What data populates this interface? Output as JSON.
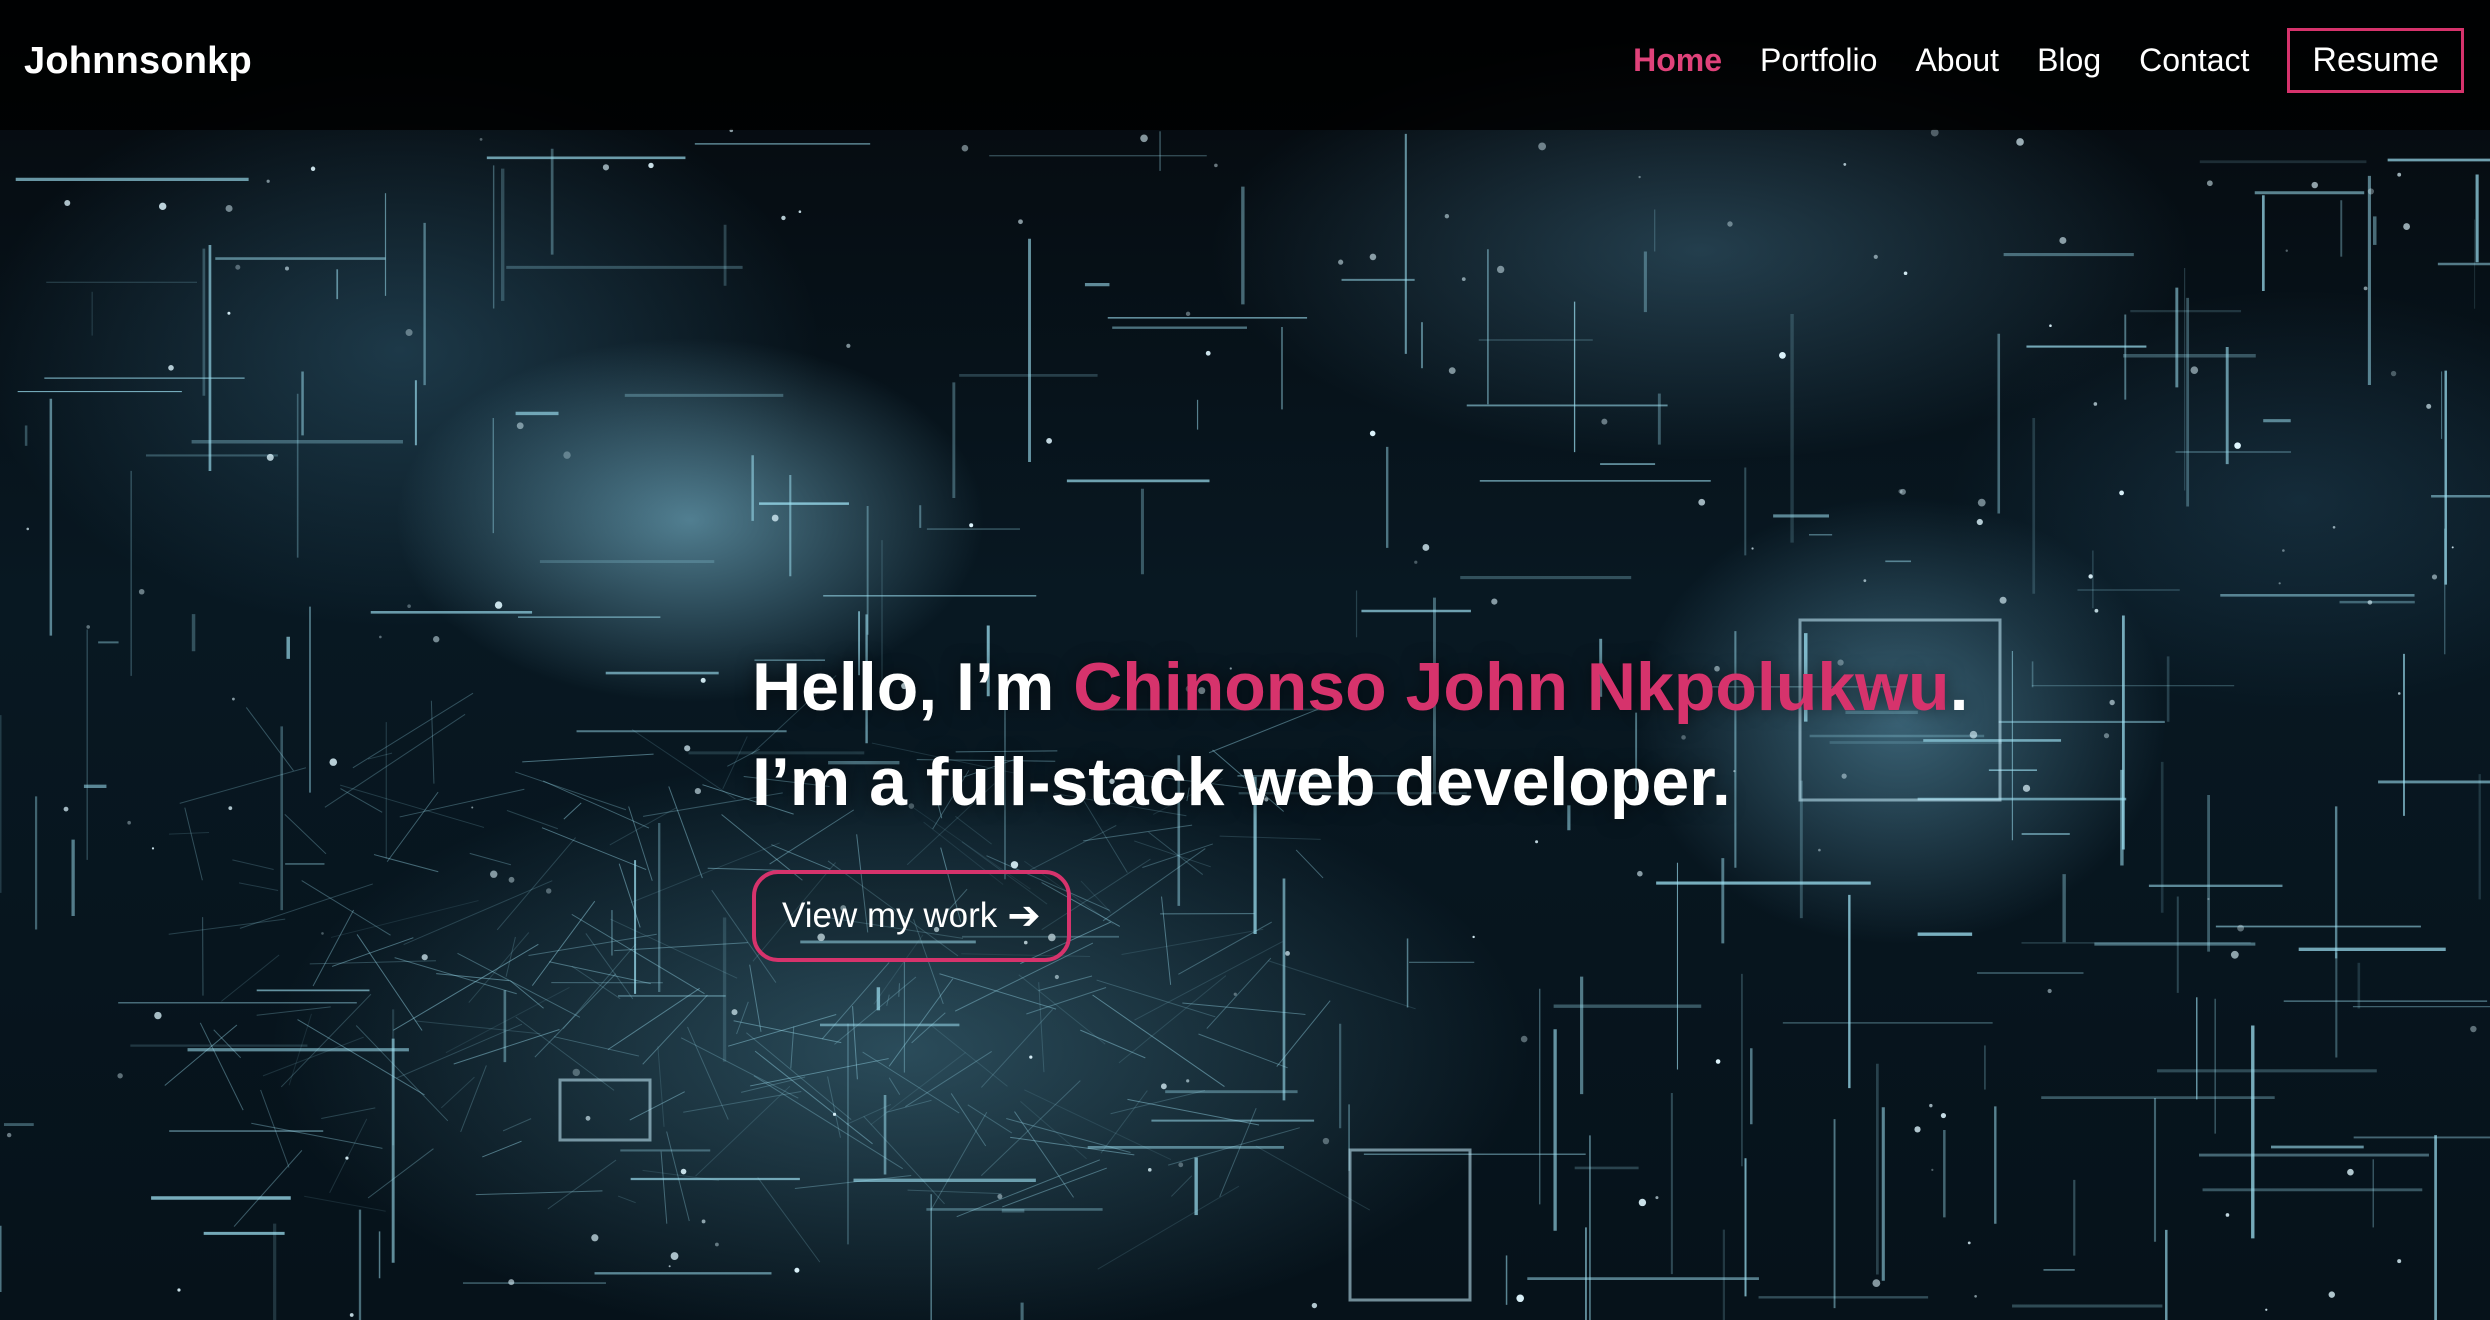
{
  "nav": {
    "brand": "Johnnsonkp",
    "items": [
      {
        "label": "Home"
      },
      {
        "label": "Portfolio"
      },
      {
        "label": "About"
      },
      {
        "label": "Blog"
      },
      {
        "label": "Contact"
      }
    ],
    "resume_label": "Resume"
  },
  "hero": {
    "greeting": "Hello, I’m ",
    "name": "Chinonso John Nkpolukwu",
    "period": ".",
    "tagline": "I’m a full-stack web developer.",
    "cta_label": "View my work",
    "cta_icon": "arrow-right-icon"
  },
  "colors": {
    "accent": "#d6336c",
    "background": "#000000",
    "text": "#ffffff",
    "art_line": "#9fe3f5"
  }
}
